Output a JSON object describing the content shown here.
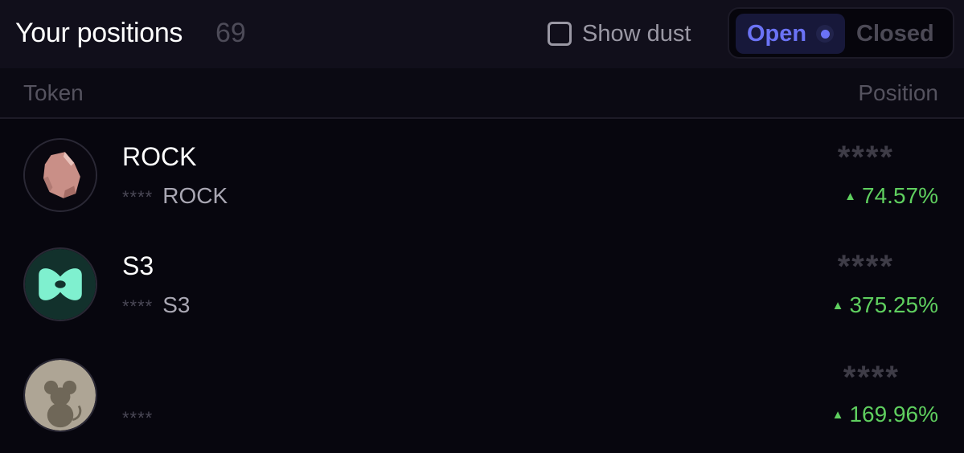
{
  "header": {
    "title": "Your positions",
    "count": "69",
    "show_dust_label": "Show dust",
    "tabs": [
      {
        "label": "Open",
        "active": true
      },
      {
        "label": "Closed",
        "active": false
      }
    ]
  },
  "columns": {
    "token": "Token",
    "position": "Position"
  },
  "rows": [
    {
      "name": "ROCK",
      "amount_masked": "****",
      "symbol": "ROCK",
      "position_masked": "****",
      "change": "74.57%",
      "icon": "rock-token-icon"
    },
    {
      "name": "S3",
      "amount_masked": "****",
      "symbol": "S3",
      "position_masked": "****",
      "change": "375.25%",
      "icon": "s3-token-icon"
    },
    {
      "name": "",
      "amount_masked": "****",
      "symbol": "",
      "position_masked": "****",
      "change": "169.96%",
      "icon": "mouse-token-icon"
    }
  ],
  "colors": {
    "accent": "#6b73f5",
    "positive": "#5fcf5f",
    "background": "#07060e"
  }
}
